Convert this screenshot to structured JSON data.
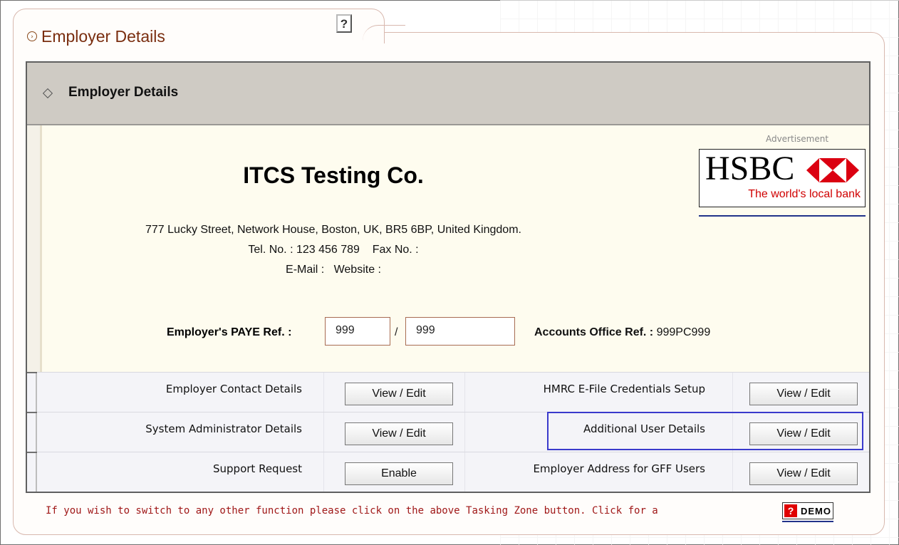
{
  "page": {
    "title": "Employer Details",
    "help_label": "?"
  },
  "section": {
    "title": "Employer Details"
  },
  "employer": {
    "name": "ITCS Testing Co.",
    "address": "777 Lucky Street, Network House, Boston, UK, BR5 6BP, United Kingdom.",
    "tel_line": "Tel. No. : 123 456 789    Fax No. :",
    "email_line": "E-Mail :   Website :",
    "paye_label": "Employer's PAYE Ref. :",
    "paye_ref_1": "999",
    "paye_separator": "/",
    "paye_ref_2": "999",
    "accounts_label": "Accounts Office Ref. :",
    "accounts_value": "999PC999"
  },
  "advertisement": {
    "label": "Advertisement",
    "brand": "HSBC",
    "tagline": "The world's local bank",
    "colors": {
      "hex_red": "#db0011",
      "tagline": "#d00000"
    }
  },
  "rows": [
    {
      "left_label": "Employer Contact Details",
      "left_button": "View / Edit",
      "right_label": "HMRC E-File Credentials Setup",
      "right_button": "View / Edit"
    },
    {
      "left_label": "System Administrator Details",
      "left_button": "View / Edit",
      "right_label": "Additional User Details",
      "right_button": "View / Edit"
    },
    {
      "left_label": "Support Request",
      "left_button": "Enable",
      "right_label": "Employer Address for GFF Users",
      "right_button": "View / Edit"
    }
  ],
  "footer": {
    "text": "If you wish to switch to any other function please click on the above Tasking Zone button. Click for a",
    "demo_icon": "?",
    "demo_label": "DEMO"
  },
  "colors": {
    "title": "#7a2e10",
    "header_bg": "#cfcbc4",
    "highlight": "#3a3acc",
    "footer_text": "#a01818"
  }
}
